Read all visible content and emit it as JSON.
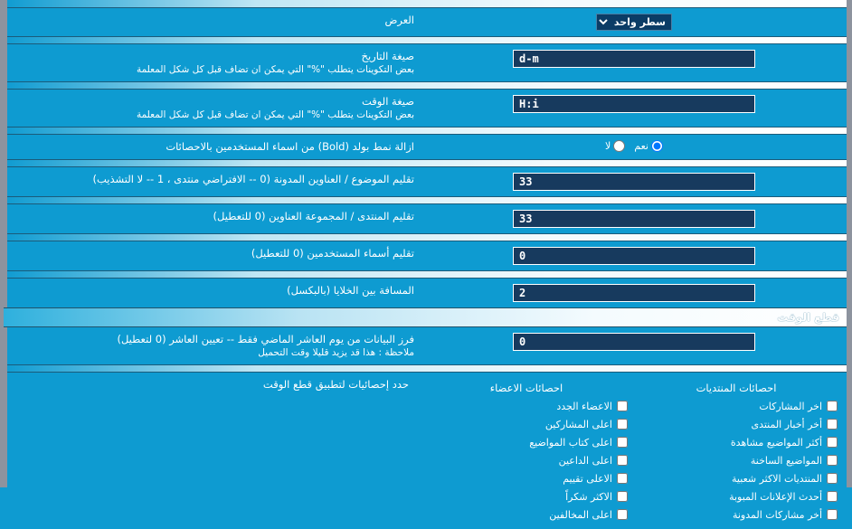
{
  "display_row": {
    "label": "العرض",
    "select_value": "سطر واحد",
    "options": [
      "سطر واحد"
    ]
  },
  "date_format_row": {
    "label": "صيغة التاريخ",
    "desc": "بعض التكوينات يتطلب \"%\" التي يمكن ان تضاف قبل كل شكل المعلمة",
    "value": "d-m"
  },
  "time_format_row": {
    "label": "صيغة الوقت",
    "desc": "بعض التكوينات يتطلب \"%\" التي يمكن ان تضاف قبل كل شكل المعلمة",
    "value": "H:i"
  },
  "bold_row": {
    "label": "ازالة نمط بولد (Bold) من اسماء المستخدمين بالاحصائات",
    "yes_label": "نعم",
    "no_label": "لا",
    "selected": "yes"
  },
  "trim_title_row": {
    "label": "تقليم الموضوع / العناوين المدونة (0 -- الافتراضي منتدى ، 1 -- لا التشذيب)",
    "value": "33"
  },
  "trim_forum_row": {
    "label": "تقليم المنتدى / المجموعة العناوين (0 للتعطيل)",
    "value": "33"
  },
  "trim_user_row": {
    "label": "تقليم أسماء المستخدمين (0 للتعطيل)",
    "value": "0"
  },
  "cellspacing_row": {
    "label": "المسافة بين الخلايا (بالبكسل)",
    "value": "2"
  },
  "section_time_cut": {
    "title": "قطع الوقت"
  },
  "time_cut_row": {
    "label": "فرز البيانات من يوم العاشر الماضي فقط -- تعيين العاشر  (0 لتعطيل)",
    "desc": "ملاحظة : هذا قد يزيد قليلا وقت التحميل",
    "value": "0"
  },
  "stats_selection": {
    "label": "حدد إحصائيات لتطبيق قطع الوقت",
    "columns": [
      {
        "header": "احصائات الاعضاء",
        "items": [
          {
            "label": "الاعضاء الجدد",
            "checked": false
          },
          {
            "label": "اعلى المشاركين",
            "checked": false
          },
          {
            "label": "اعلى كتاب المواضيع",
            "checked": false
          },
          {
            "label": "اعلى الداعين",
            "checked": false
          },
          {
            "label": "الاعلى تقييم",
            "checked": false
          },
          {
            "label": "الاكثر شكراً",
            "checked": false
          },
          {
            "label": "اعلى المخالفين",
            "checked": false
          }
        ]
      },
      {
        "header": "احصائات المنتديات",
        "items": [
          {
            "label": "اخر المشاركات",
            "checked": false
          },
          {
            "label": "أخر أخبار المنتدى",
            "checked": false
          },
          {
            "label": "أكثر المواضيع مشاهدة",
            "checked": false
          },
          {
            "label": "المواضيع الساخنة",
            "checked": false
          },
          {
            "label": "المنتديات الاكثر شعبية",
            "checked": false
          },
          {
            "label": "أحدث الإعلانات المبوبة",
            "checked": false
          },
          {
            "label": "أخر مشاركات المدونة",
            "checked": false
          }
        ]
      }
    ]
  },
  "colors": {
    "page_bg": "#0e9bd1",
    "input_bg": "#173a5e",
    "rail": "#8d939e"
  }
}
